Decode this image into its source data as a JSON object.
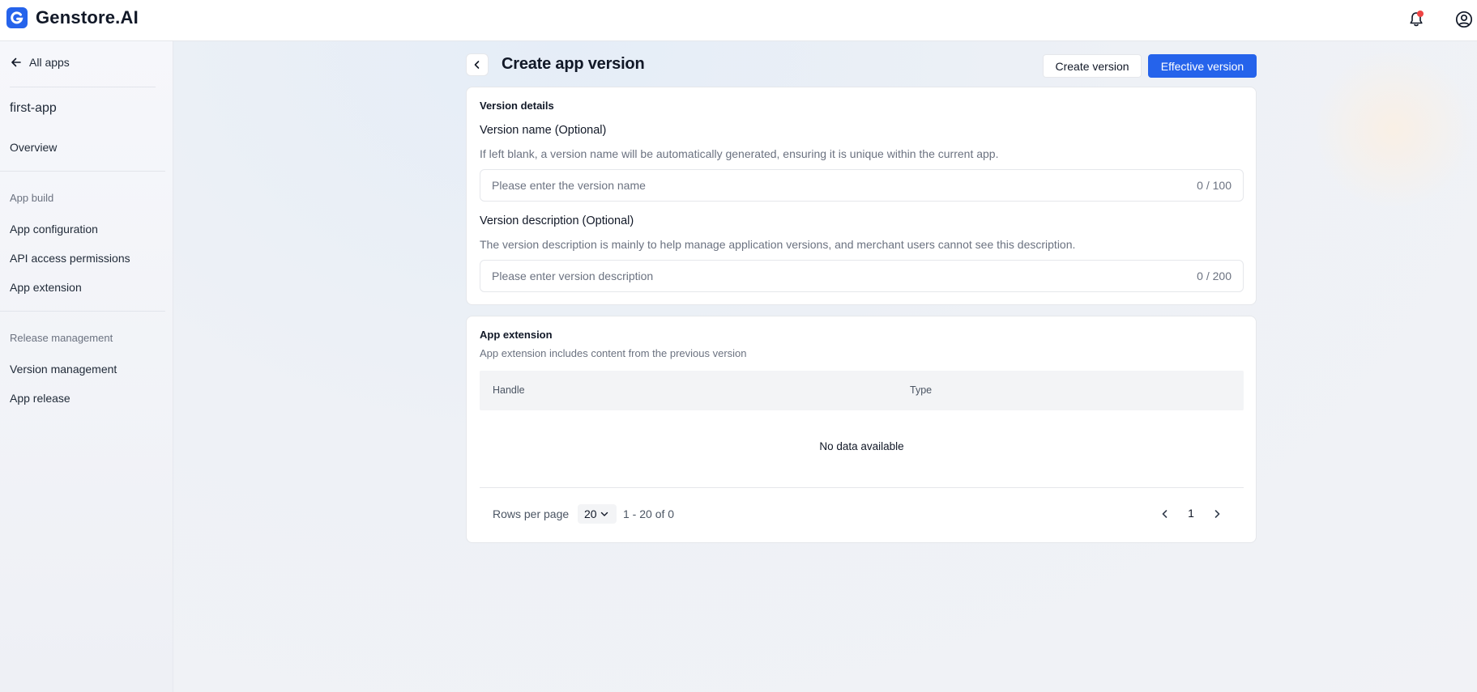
{
  "brand": {
    "name": "Genstore.AI",
    "accent_color": "#2563eb"
  },
  "topbar": {
    "notification_icon": "bell-icon",
    "account_icon": "user-circle-icon"
  },
  "sidebar": {
    "back_label": "All apps",
    "app_name": "first-app",
    "overview": "Overview",
    "section_build": "App build",
    "build_items": [
      "App configuration",
      "API access permissions",
      "App extension"
    ],
    "section_release": "Release management",
    "release_items": [
      "Version management",
      "App release"
    ]
  },
  "header": {
    "title": "Create app version",
    "create_button": "Create version",
    "effective_button": "Effective version"
  },
  "version_details": {
    "title": "Version details",
    "name_label": "Version name (Optional)",
    "name_help": "If left blank, a version name will be automatically generated, ensuring it is unique within the current app.",
    "name_placeholder": "Please enter the version name",
    "name_value": "",
    "name_counter": "0 / 100",
    "desc_label": "Version description (Optional)",
    "desc_help": "The version description is mainly to help manage application versions, and merchant users cannot see this description.",
    "desc_placeholder": "Please enter version description",
    "desc_value": "",
    "desc_counter": "0 / 200"
  },
  "extension": {
    "title": "App extension",
    "subtitle": "App extension includes content from the previous version",
    "columns": [
      "Handle",
      "Type"
    ],
    "empty_text": "No data available",
    "rows_per_page_label": "Rows per page",
    "rows_per_page_value": "20",
    "range_text": "1 - 20 of 0",
    "current_page": "1"
  }
}
